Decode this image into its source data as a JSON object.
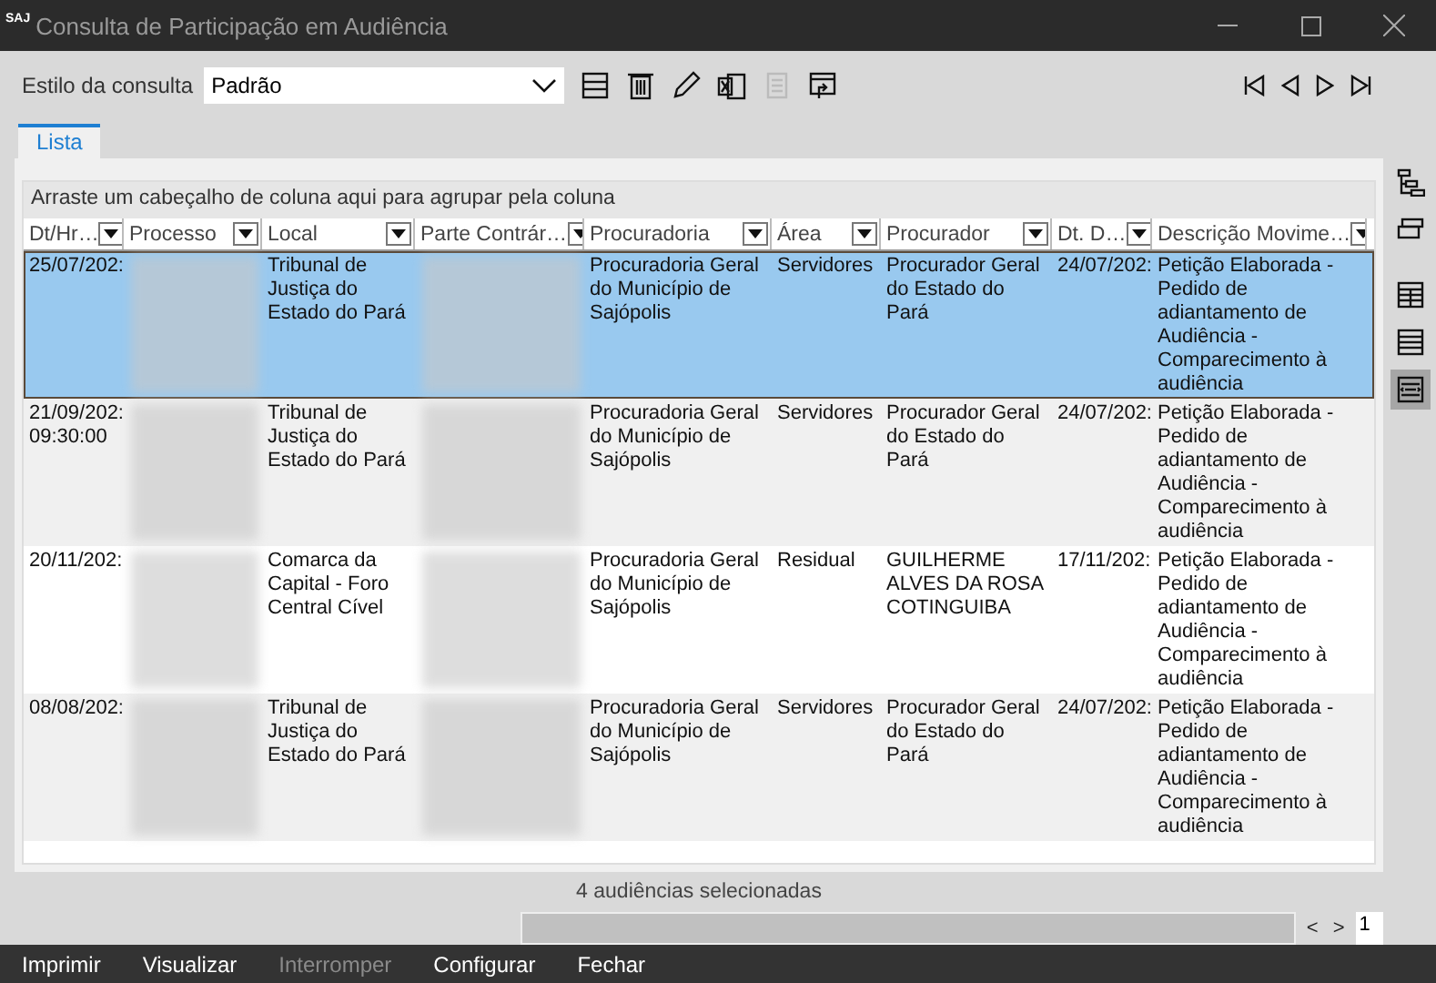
{
  "window": {
    "logo": "SAJ",
    "title": "Consulta de Participação em Audiência"
  },
  "query_style": {
    "label": "Estilo da consulta",
    "value": "Padrão"
  },
  "toolbar": [
    {
      "kind": "save",
      "disabled": false
    },
    {
      "kind": "trash",
      "disabled": false
    },
    {
      "kind": "pencil",
      "disabled": false
    },
    {
      "kind": "excel",
      "disabled": false
    },
    {
      "kind": "document",
      "disabled": true
    },
    {
      "kind": "export",
      "disabled": false
    }
  ],
  "navigation": [
    {
      "kind": "first"
    },
    {
      "kind": "prev"
    },
    {
      "kind": "next"
    },
    {
      "kind": "last"
    }
  ],
  "view_buttons": [
    {
      "kind": "tree",
      "selected": false
    },
    {
      "kind": "group",
      "selected": false
    },
    {
      "kind": "table",
      "selected": false
    },
    {
      "kind": "list",
      "selected": false
    },
    {
      "kind": "detail",
      "selected": true
    }
  ],
  "tabs": [
    {
      "label": "Lista",
      "selected": true
    }
  ],
  "group_hint": "Arraste um cabeçalho de coluna aqui para agrupar pela coluna",
  "table": {
    "columns": [
      {
        "label": "Dt/Hr…",
        "kind": "text"
      },
      {
        "label": "Processo",
        "kind": "blurred"
      },
      {
        "label": "Local",
        "kind": "text"
      },
      {
        "label": "Parte Contrár…",
        "kind": "blurred"
      },
      {
        "label": "Procuradoria",
        "kind": "text"
      },
      {
        "label": "Área",
        "kind": "text"
      },
      {
        "label": "Procurador",
        "kind": "text"
      },
      {
        "label": "Dt. D…",
        "kind": "text"
      },
      {
        "label": "Descrição Movime…",
        "kind": "text"
      }
    ],
    "rows": [
      {
        "selected": true,
        "cells": [
          "25/07/202:",
          "",
          "Tribunal de Justiça do Estado do Pará",
          "",
          "Procuradoria Geral do Município de Sajópolis",
          "Servidores",
          "Procurador Geral do Estado do Pará",
          "24/07/202:",
          "Petição Elaborada - Pedido de adiantamento de Audiência - Comparecimento à audiência"
        ]
      },
      {
        "selected": false,
        "cells": [
          "21/09/202: 09:30:00",
          "",
          "Tribunal de Justiça do Estado do Pará",
          "",
          "Procuradoria Geral do Município de Sajópolis",
          "Servidores",
          "Procurador Geral do Estado do Pará",
          "24/07/202:",
          "Petição Elaborada - Pedido de adiantamento de Audiência - Comparecimento à audiência"
        ]
      },
      {
        "selected": false,
        "cells": [
          "20/11/202:",
          "",
          "Comarca da Capital - Foro Central Cível",
          "",
          "Procuradoria Geral do Município de Sajópolis",
          "Residual",
          "GUILHERME ALVES DA ROSA COTINGUIBA",
          "17/11/202:",
          "Petição Elaborada - Pedido de adiantamento de Audiência - Comparecimento à audiência"
        ]
      },
      {
        "selected": false,
        "cells": [
          "08/08/202:",
          "",
          "Tribunal de Justiça do Estado do Pará",
          "",
          "Procuradoria Geral do Município de Sajópolis",
          "Servidores",
          "Procurador Geral do Estado do Pará",
          "24/07/202:",
          "Petição Elaborada - Pedido de adiantamento de Audiência - Comparecimento à audiência"
        ]
      }
    ]
  },
  "status": "4 audiências selecionadas",
  "pager": {
    "prev": "<",
    "next": ">",
    "page": "1"
  },
  "buttons": [
    {
      "label": "Imprimir",
      "disabled": false
    },
    {
      "label": "Visualizar",
      "disabled": false
    },
    {
      "label": "Interromper",
      "disabled": true
    },
    {
      "label": "Configurar",
      "disabled": false
    },
    {
      "label": "Fechar",
      "disabled": false
    }
  ]
}
